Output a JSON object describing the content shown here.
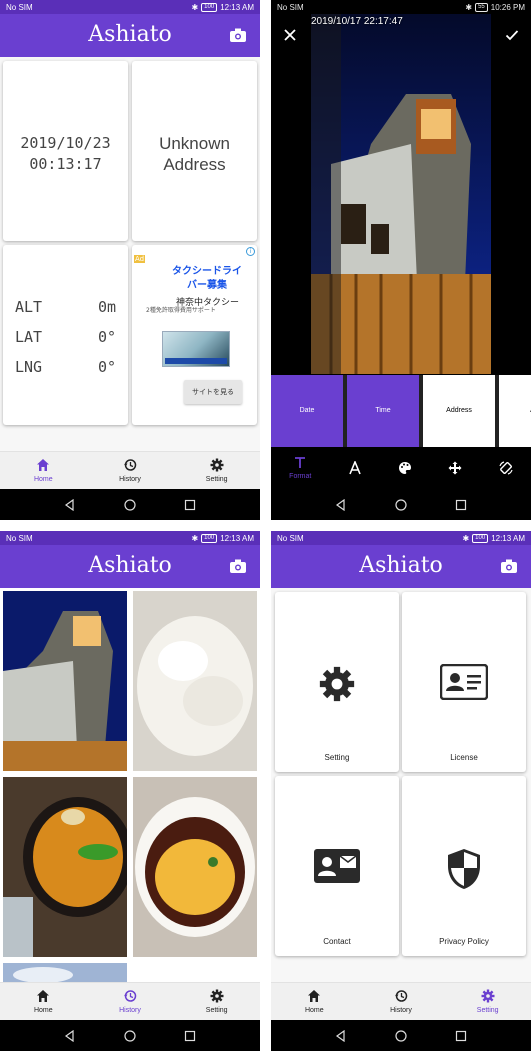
{
  "status": {
    "left": "No SIM",
    "battery": "100",
    "time": "12:13 AM",
    "editor_battery": "55",
    "editor_time": "10:26 PM"
  },
  "app": {
    "title": "Ashiato",
    "camera_icon": "camera-icon"
  },
  "home": {
    "date": "2019/10/23",
    "time": "00:13:17",
    "address_line1": "Unknown",
    "address_line2": "Address",
    "alt_label": "ALT",
    "alt_value": "0m",
    "lat_label": "LAT",
    "lat_value": "0°",
    "lng_label": "LNG",
    "lng_value": "0°",
    "ad": {
      "badge": "Ad",
      "title": "タクシードライバー募集",
      "subtitle": "神奈中タクシー",
      "description": "2種免許取得費用サポート",
      "cta": "サイトを見る"
    }
  },
  "nav": {
    "home": "Home",
    "history": "History",
    "setting": "Setting"
  },
  "editor": {
    "stamp": "2019/10/17 22:17:47",
    "options": [
      "Date",
      "Time",
      "Address",
      "Alti"
    ],
    "tools": {
      "format": "Format"
    }
  },
  "settings": {
    "items": [
      "Setting",
      "License",
      "Contact",
      "Privacy Policy"
    ]
  },
  "colors": {
    "accent": "#6a3fd0",
    "status": "#5a2fb8"
  }
}
